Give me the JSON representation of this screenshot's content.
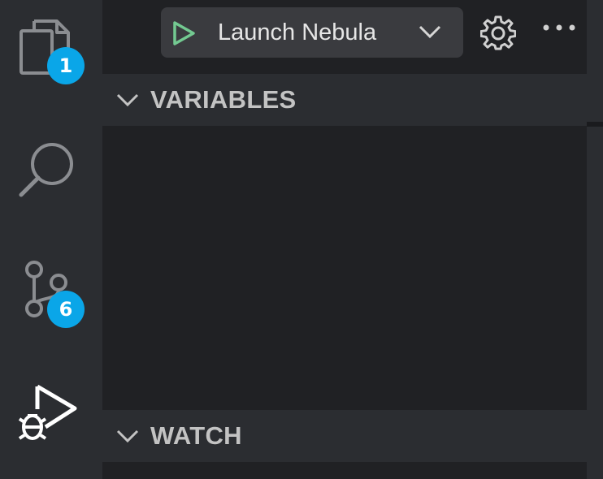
{
  "activity_bar": {
    "explorer": {
      "icon": "files-icon",
      "badge": "1"
    },
    "search": {
      "icon": "search-icon"
    },
    "source_control": {
      "icon": "source-control-icon",
      "badge": "6"
    },
    "run_debug": {
      "icon": "run-debug-icon",
      "active": true
    }
  },
  "toolbar": {
    "run_icon": "play-icon",
    "launch_config": "Launch Nebula",
    "dropdown_icon": "chevron-down-icon",
    "settings_icon": "gear-icon",
    "more_icon": "ellipsis-icon"
  },
  "sections": {
    "variables": {
      "title": "VARIABLES",
      "expanded": true
    },
    "watch": {
      "title": "WATCH",
      "expanded": true
    }
  },
  "colors": {
    "badge": "#0aa6e8",
    "play": "#73c991",
    "background": "#202124",
    "panel": "#2b2d31"
  }
}
